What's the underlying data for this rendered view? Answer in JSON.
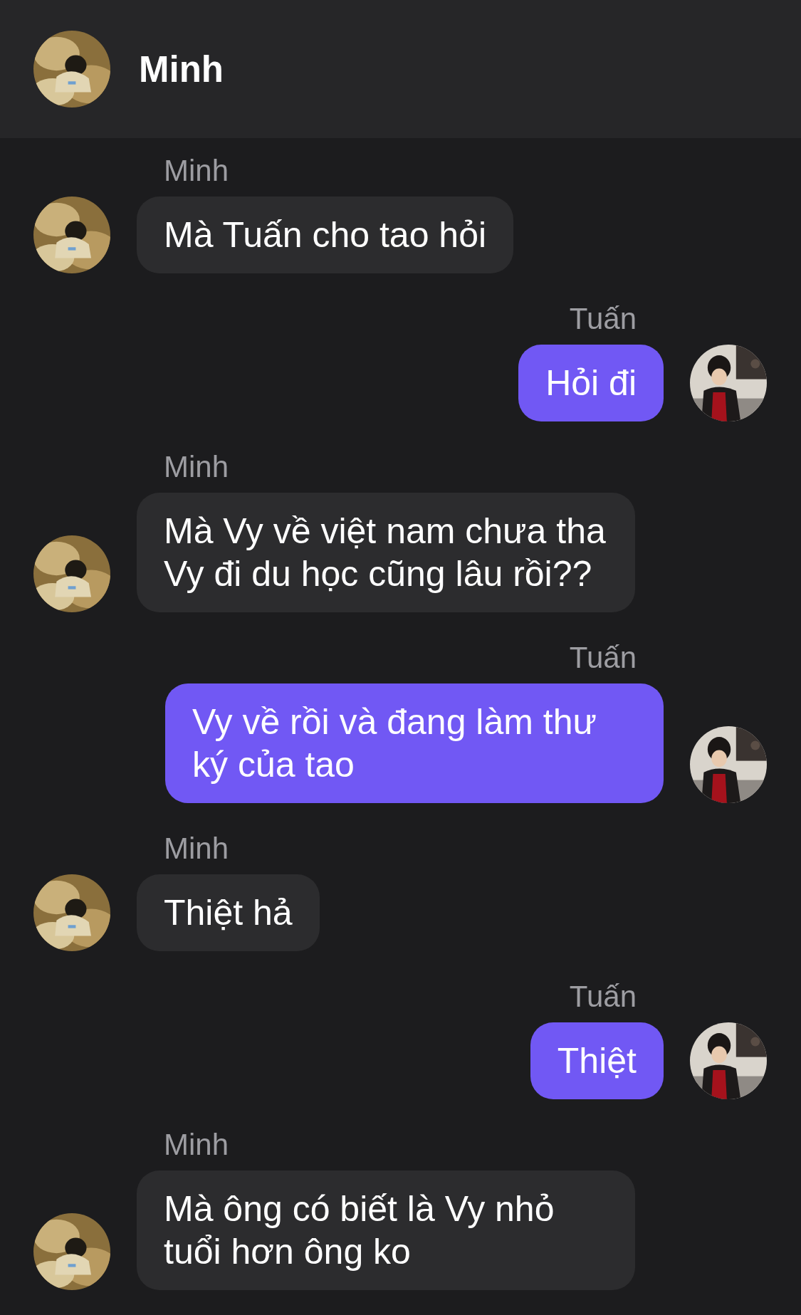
{
  "header": {
    "title": "Minh"
  },
  "messages": [
    {
      "sender": "Minh",
      "kind": "incoming",
      "text": "Mà Tuấn cho tao hỏi"
    },
    {
      "sender": "Tuấn",
      "kind": "outgoing",
      "text": "Hỏi đi"
    },
    {
      "sender": "Minh",
      "kind": "incoming",
      "text": "Mà Vy về việt nam chưa tha Vy đi du học cũng lâu rồi??"
    },
    {
      "sender": "Tuấn",
      "kind": "outgoing",
      "text": "Vy về rồi và đang làm thư ký của tao"
    },
    {
      "sender": "Minh",
      "kind": "incoming",
      "text": "Thiệt hả"
    },
    {
      "sender": "Tuấn",
      "kind": "outgoing",
      "text": "Thiệt"
    },
    {
      "sender": "Minh",
      "kind": "incoming",
      "text": "Mà ông có biết là Vy nhỏ tuổi hơn ông ko"
    }
  ]
}
